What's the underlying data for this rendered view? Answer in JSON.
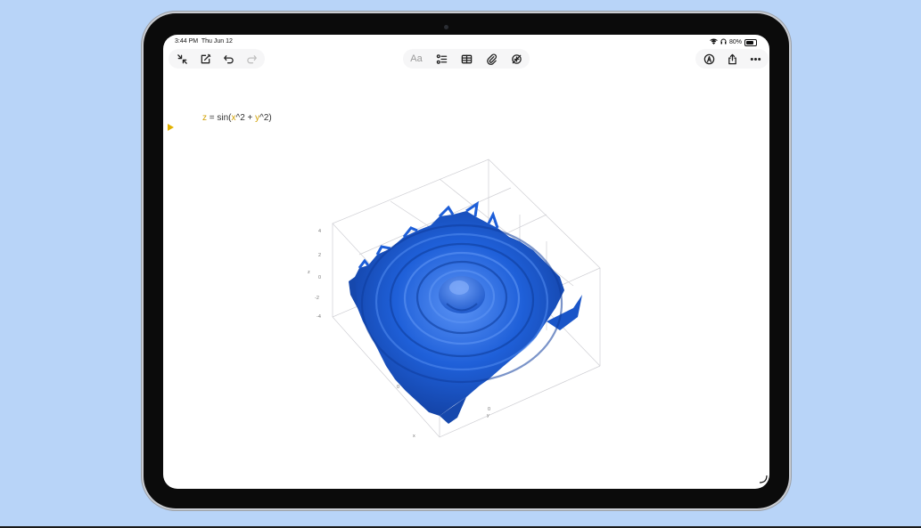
{
  "status_bar": {
    "time": "3:44 PM",
    "date": "Thu Jun 12",
    "battery": "80%",
    "battery_level": 0.8
  },
  "toolbar_left": {
    "icons": [
      "collapse-icon",
      "compose-icon",
      "undo-icon",
      "redo-icon"
    ]
  },
  "toolbar_center": {
    "text_format_label": "Aa",
    "icons": [
      "checklist-icon",
      "table-icon",
      "attachment-icon",
      "math-icon"
    ]
  },
  "toolbar_right": {
    "icons": [
      "markup-icon",
      "share-icon",
      "more-icon"
    ]
  },
  "note": {
    "equation": {
      "lhs": "z",
      "equals": " = sin(",
      "x": "x",
      "mid": "^2 + ",
      "y": "y",
      "tail": "^2)"
    }
  },
  "plot": {
    "z_ticks": [
      "4",
      "2",
      "0",
      "-2",
      "-4"
    ],
    "z_axis_label": "z",
    "x_axis_label": "x",
    "y_axis_label": "y",
    "x_ticks": [
      "0"
    ],
    "y_ticks": [
      "0"
    ],
    "surface_color": "#1d5ed8",
    "surface_shadow": "#0e3d9e",
    "surface_highlight": "#4c86f0"
  }
}
